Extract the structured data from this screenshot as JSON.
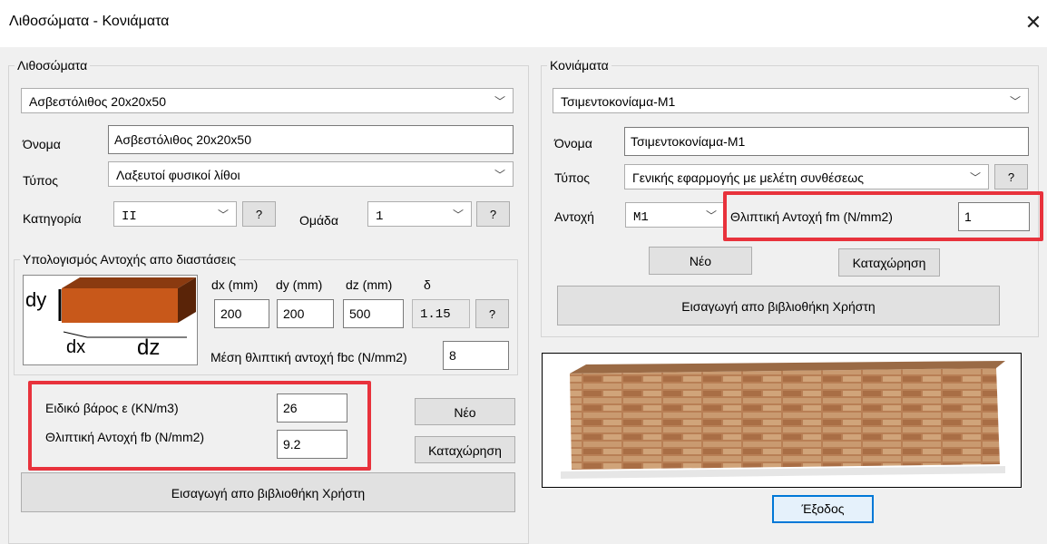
{
  "window": {
    "title": "Λιθοσώματα - Κονιάματα",
    "close_symbol": "✕"
  },
  "stone": {
    "group_title": "Λιθοσώματα",
    "preset": "Ασβεστόλιθος 20x20x50",
    "name_label": "Όνομα",
    "name_value": "Ασβεστόλιθος 20x20x50",
    "type_label": "Τύπος",
    "type_value": "Λαξευτοί φυσικοί λίθοι",
    "category_label": "Κατηγορία",
    "category_value": "II",
    "group_label": "Ομάδα",
    "group_value": "1",
    "help": "?",
    "dims": {
      "group_title": "Υπολογισμός Αντοχής απο διαστάσεις",
      "dx_label": "dx (mm)",
      "dy_label": "dy (mm)",
      "dz_label": "dz (mm)",
      "delta_label": "δ",
      "dx": "200",
      "dy": "200",
      "dz": "500",
      "delta": "1.15",
      "img_dy": "dy",
      "img_dx": "dx",
      "img_dz": "dz",
      "mean_label": "Μέση θλιπτική αντοχή fbc (N/mm2)",
      "mean_value": "8"
    },
    "weight_label": "Ειδικό βάρος ε (KN/m3)",
    "weight_value": "26",
    "strength_label": "Θλιπτική Αντοχή fb (N/mm2)",
    "strength_value": "9.2",
    "new_btn": "Νέο",
    "save_btn": "Καταχώρηση",
    "import_btn": "Εισαγωγή απο βιβλιοθήκη Χρήστη"
  },
  "mortar": {
    "group_title": "Κονιάματα",
    "preset": "Τσιμεντοκονίαμα-Μ1",
    "name_label": "Όνομα",
    "name_value": "Τσιμεντοκονίαμα-Μ1",
    "type_label": "Τύπος",
    "type_value": "Γενικής εφαρμογής με μελέτη συνθέσεως",
    "resist_label": "Αντοχή",
    "resist_value": "M1",
    "fm_label": "Θλιπτική Αντοχή fm (N/mm2)",
    "fm_value": "1",
    "help": "?",
    "new_btn": "Νέο",
    "save_btn": "Καταχώρηση",
    "import_btn": "Εισαγωγή απο βιβλιοθήκη Χρήστη"
  },
  "exit_btn": "Έξοδος",
  "colors": {
    "highlight": "#e8323c",
    "brick": "#c8581a",
    "focus": "#0078d7"
  }
}
